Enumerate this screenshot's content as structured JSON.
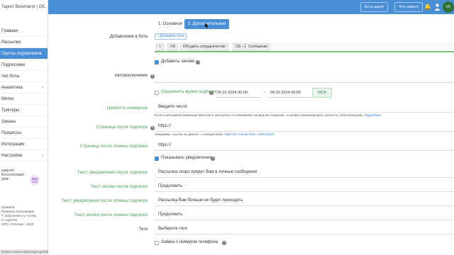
{
  "header": {
    "project_title": "Таргет Вконтакте | Об...",
    "idea_button": "Есть идея!",
    "whats_new_button": "Что нового",
    "avatar_text": "VK"
  },
  "sidebar": {
    "items": [
      {
        "label": "Главная",
        "chevron": ""
      },
      {
        "label": "Рассылки",
        "chevron": ""
      },
      {
        "label": "Группы подписчиков",
        "chevron": ""
      },
      {
        "label": "Подписчики",
        "chevron": ""
      },
      {
        "label": "Чат-боты",
        "chevron": ""
      },
      {
        "label": "Аналитика",
        "chevron": "›"
      },
      {
        "label": "Метки",
        "chevron": ""
      },
      {
        "label": "Триггеры",
        "chevron": ""
      },
      {
        "label": "Заказы",
        "chevron": ""
      },
      {
        "label": "Процессы",
        "chevron": ""
      },
      {
        "label": "Интеграции",
        "chevron": ""
      },
      {
        "label": "Настройки",
        "chevron": "›"
      }
    ],
    "promo": [
      "support!",
      "Консультация",
      "урок"
    ],
    "footer": [
      "Правила",
      "Правила пользования",
      "© 2014 senler.ru • ✉ Мы",
      "в соцсетях",
      "ООО «Сенлер», 2022"
    ],
    "statusbar": "senler.ru/subscriptions/group/edit?gid=..."
  },
  "tabs": {
    "main": "1. Основное",
    "additional": "2. Дополнительное"
  },
  "form": {
    "add_to_bot_label": "Добавление в бота",
    "add_bot_button": "+ Добавить бота",
    "bot_chip_remove": "×",
    "bot_chip_os": "OS",
    "bot_chip_name": "Обсудить сотрудничество",
    "bot_chip_step": "OS - 1",
    "bot_chip_message": "Сообщение",
    "add_again_label": "Добавить заново",
    "auto_exclusion_label": "Автоисключение",
    "time_limit_label": "Ограничить время подписки",
    "date_from": "25.01.2024 00:00",
    "date_dash": "-",
    "date_to": "04.02.2024 00:00",
    "timezone": "МСК",
    "conversion_label": "Ценность конверсии",
    "conversion_placeholder": "Введите число",
    "conversion_hint": "Если в рекламной кампании Вконтакте настроено отслеживание конверсии подписки, то можно анализировать ценность этой конверсии.",
    "conversion_hint_link": "Подробнее",
    "page_after_sub_label": "Страница после подписки",
    "page_after_sub_value": "https://",
    "page_after_sub_hint": "Например, ссылка на диалог с сообществом:",
    "page_after_sub_hint_link": "https://vk.com/im?sel=-216043224",
    "page_after_unsub_label": "Страница после отмены подписки",
    "page_after_unsub_value": "https://",
    "show_notifications_label": "Показывать уведомления",
    "notif_after_sub_label": "Текст уведомления после подписки",
    "notif_after_sub_value": "Рассылка скоро придет Вам в личные сообщения",
    "button_after_sub_label": "Текст кнопки после подписки",
    "button_after_sub_value": "Продолжить",
    "notif_after_unsub_label": "Текст уведомления после отмены подписки",
    "notif_after_unsub_value": "Рассылка Вам больше не будет приходить",
    "button_after_unsub_label": "Текст кнопки после отмены подписки",
    "button_after_unsub_value": "Продолжить",
    "tags_label": "Теги",
    "tags_placeholder": "Выберите теги",
    "phone_request_label": "Заявка с номером телефона",
    "help_glyph": "?"
  },
  "colors": {
    "accent": "#4a8ed6",
    "green_label": "#4a9c5a",
    "link": "#3a7bc8"
  },
  "icons": [
    "bell-icon",
    "user-icon",
    "chevron-right-icon",
    "gift-icon",
    "help-icon",
    "checkbox-icon",
    "cursor-icon"
  ]
}
